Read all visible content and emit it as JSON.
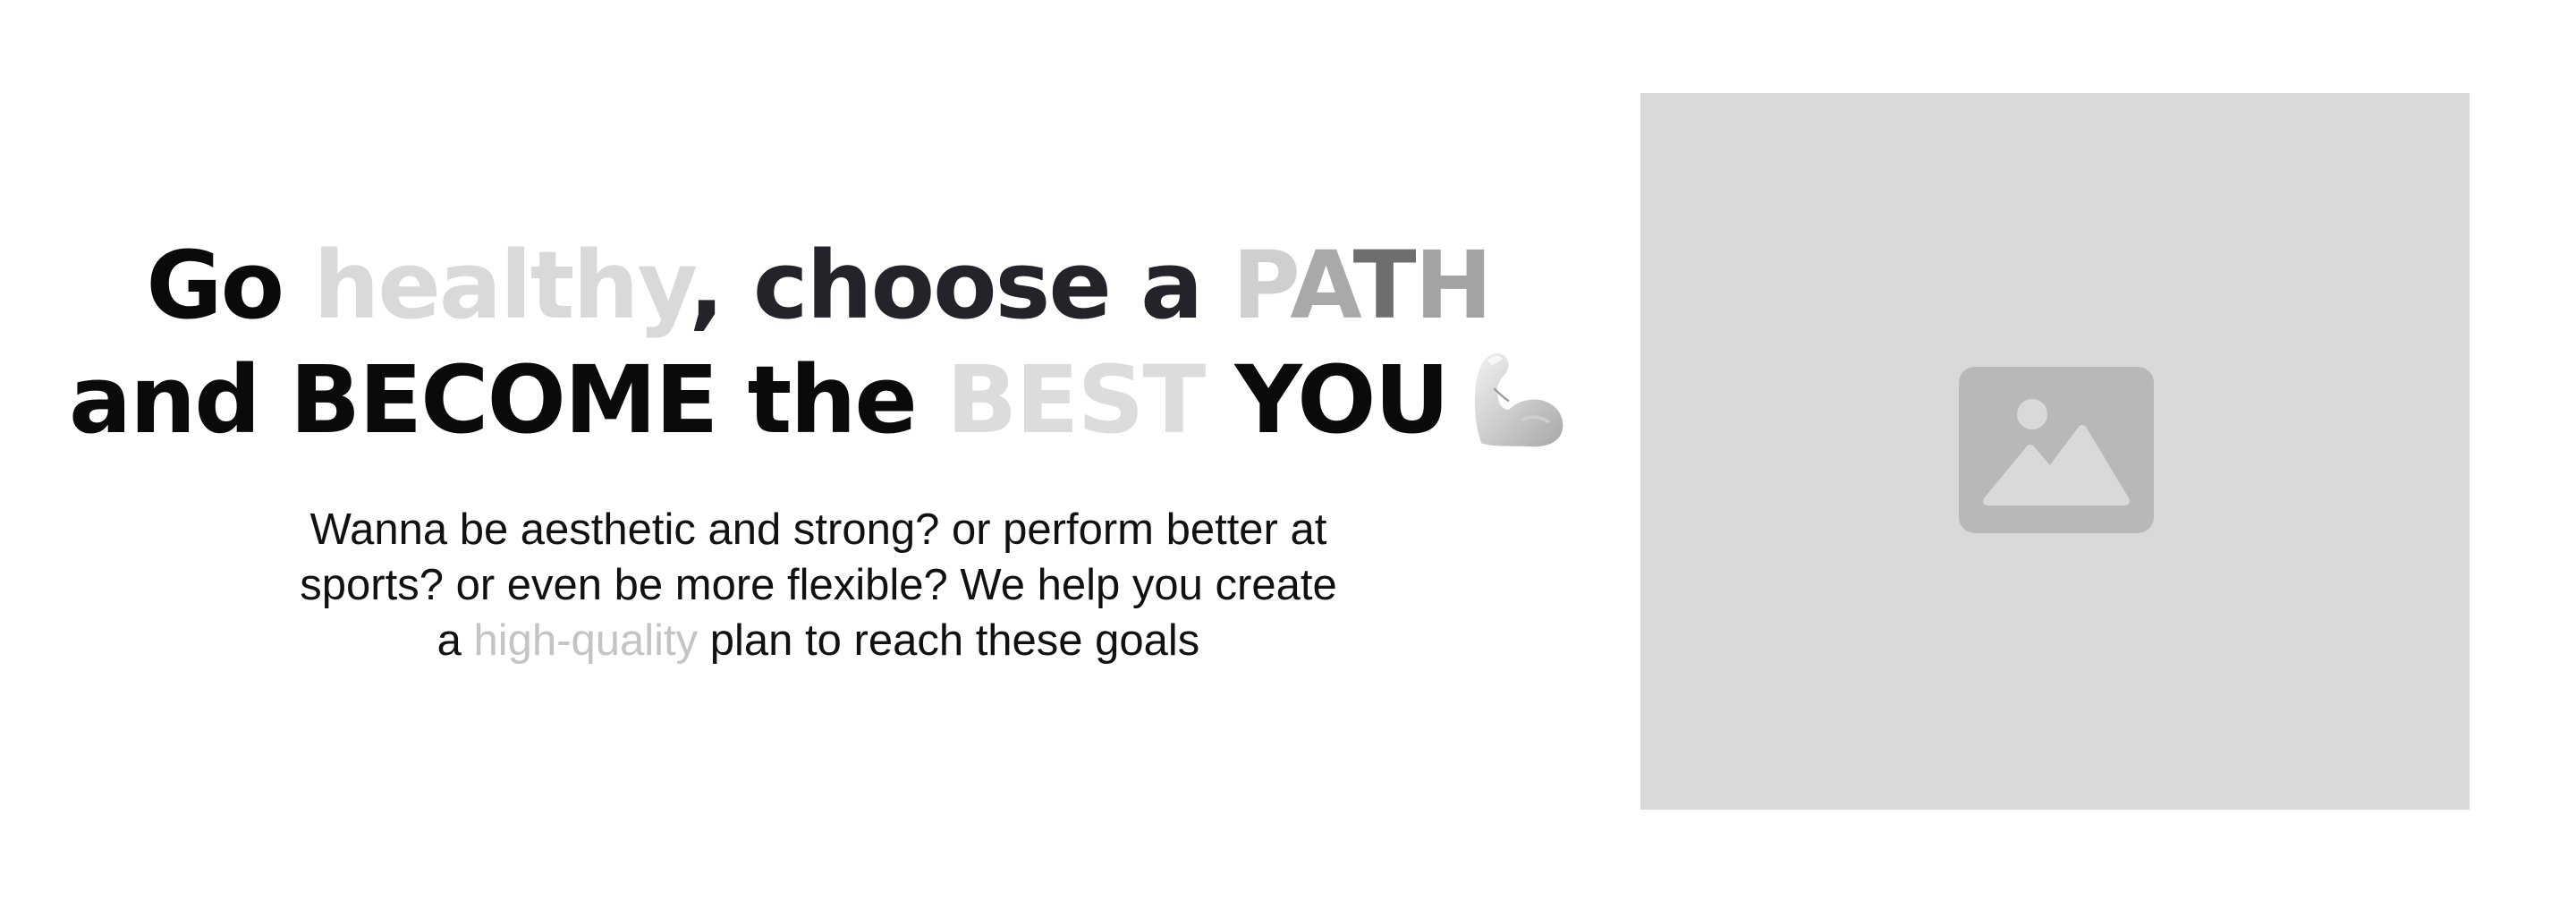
{
  "hero": {
    "headline": {
      "line1": {
        "go": "Go ",
        "healthy": "healthy",
        "choose": ", choose a ",
        "path_p": "P",
        "path_a": "A",
        "path_t": "T",
        "path_h": "H"
      },
      "line2": {
        "become": "and BECOME the ",
        "best": "BEST",
        "you": " YOU"
      }
    },
    "subtext": {
      "line1": "Wanna be aesthetic and strong? or perform better at",
      "line2": "sports? or even be more flexible? We help you create",
      "line3_start": "a ",
      "highlight": "high-quality",
      "line3_end": " plan to reach these goals"
    },
    "icons": {
      "flex": "flexed-biceps-icon",
      "image": "image-placeholder-icon"
    },
    "colors": {
      "background": "#ffffff",
      "text": "#0a0a0a",
      "muted_highlight": "#d9d9d9",
      "placeholder_bg": "#d9d9d9",
      "placeholder_icon": "#b8b8b8"
    }
  }
}
